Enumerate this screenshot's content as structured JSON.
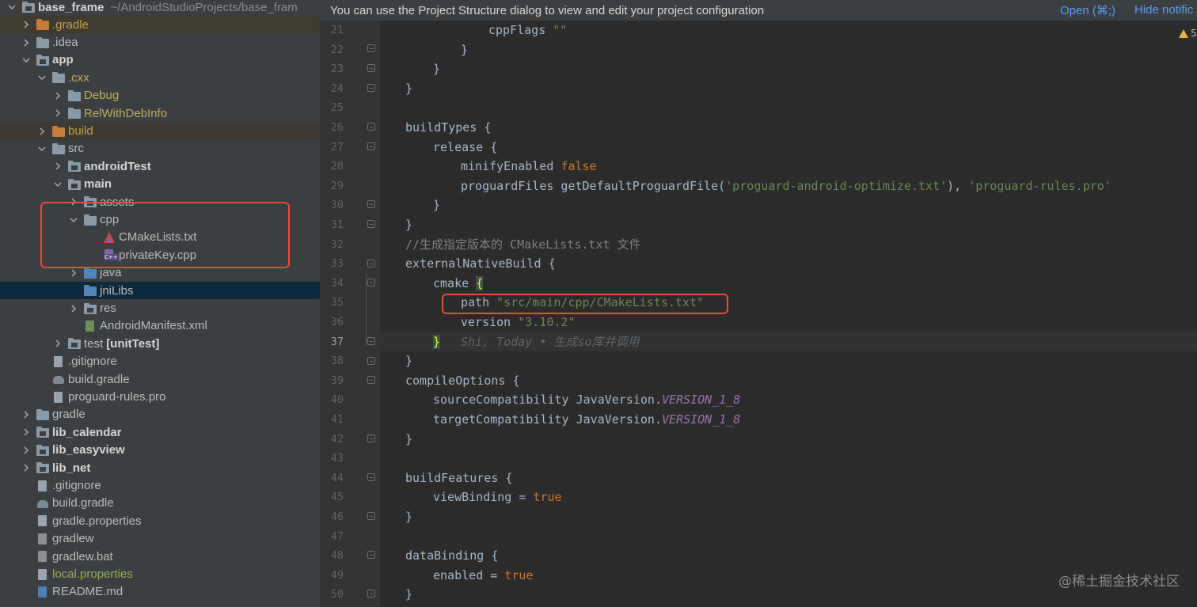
{
  "project_tree": {
    "header": {
      "name": "base_frame",
      "path": "~/AndroidStudioProjects/base_fram"
    },
    "items": [
      {
        "label": ".gradle"
      },
      {
        "label": ".idea"
      },
      {
        "label": "app"
      },
      {
        "label": ".cxx"
      },
      {
        "label": "Debug"
      },
      {
        "label": "RelWithDebInfo"
      },
      {
        "label": "build"
      },
      {
        "label": "src"
      },
      {
        "label": "androidTest"
      },
      {
        "label": "main"
      },
      {
        "label": "assets"
      },
      {
        "label": "cpp"
      },
      {
        "label": "CMakeLists.txt"
      },
      {
        "label": "privateKey.cpp"
      },
      {
        "label": "java"
      },
      {
        "label": "jniLibs"
      },
      {
        "label": "res"
      },
      {
        "label": "AndroidManifest.xml"
      },
      {
        "label": "test",
        "extra": "[unitTest]"
      },
      {
        "label": ".gitignore"
      },
      {
        "label": "build.gradle"
      },
      {
        "label": "proguard-rules.pro"
      },
      {
        "label": "gradle"
      },
      {
        "label": "lib_calendar"
      },
      {
        "label": "lib_easyview"
      },
      {
        "label": "lib_net"
      },
      {
        "label": ".gitignore"
      },
      {
        "label": "build.gradle"
      },
      {
        "label": "gradle.properties"
      },
      {
        "label": "gradlew"
      },
      {
        "label": "gradlew.bat"
      },
      {
        "label": "local.properties"
      },
      {
        "label": "README.md"
      }
    ]
  },
  "notification": {
    "message": "You can use the Project Structure dialog to view and edit your project configuration",
    "open_link": "Open (⌘;)",
    "hide_link": "Hide notific"
  },
  "editor": {
    "warning_count": "5",
    "current_line": 37,
    "lines": [
      {
        "no": "21"
      },
      {
        "no": "22"
      },
      {
        "no": "23"
      },
      {
        "no": "24"
      },
      {
        "no": "25"
      },
      {
        "no": "26"
      },
      {
        "no": "27"
      },
      {
        "no": "28"
      },
      {
        "no": "29"
      },
      {
        "no": "30"
      },
      {
        "no": "31"
      },
      {
        "no": "32"
      },
      {
        "no": "33"
      },
      {
        "no": "34"
      },
      {
        "no": "35"
      },
      {
        "no": "36"
      },
      {
        "no": "37"
      },
      {
        "no": "38"
      },
      {
        "no": "39"
      },
      {
        "no": "40"
      },
      {
        "no": "41"
      },
      {
        "no": "42"
      },
      {
        "no": "43"
      },
      {
        "no": "44"
      },
      {
        "no": "45"
      },
      {
        "no": "46"
      },
      {
        "no": "47"
      },
      {
        "no": "48"
      },
      {
        "no": "49"
      },
      {
        "no": "50"
      }
    ],
    "code": {
      "l21": {
        "t1": "cppFlags ",
        "t2": "\"\""
      },
      "l22": {
        "t1": "}"
      },
      "l23": {
        "t1": "}"
      },
      "l24": {
        "t1": "}"
      },
      "l26": {
        "t1": "buildTypes {"
      },
      "l27": {
        "t1": "release {"
      },
      "l28": {
        "t1": "minifyEnabled ",
        "t2": "false"
      },
      "l29": {
        "t1": "proguardFiles getDefaultProguardFile(",
        "t2": "'proguard-android-optimize.txt'",
        "t3": "), ",
        "t4": "'proguard-rules.pro'"
      },
      "l30": {
        "t1": "}"
      },
      "l31": {
        "t1": "}"
      },
      "l32": {
        "t1": "//生成指定版本的 CMakeLists.txt 文件"
      },
      "l33": {
        "t1": "externalNativeBuild {"
      },
      "l34": {
        "t1": "cmake ",
        "t2": "{"
      },
      "l35": {
        "t1": "path ",
        "t2": "\"src/main/cpp/CMakeLists.txt\""
      },
      "l36": {
        "t1": "version ",
        "t2": "\"3.10.2\""
      },
      "l37": {
        "t1": "}",
        "t2": "Shi, Today • 生成so库并调用"
      },
      "l38": {
        "t1": "}"
      },
      "l39": {
        "t1": "compileOptions {"
      },
      "l40": {
        "t1": "sourceCompatibility JavaVersion.",
        "t2": "VERSION_1_8"
      },
      "l41": {
        "t1": "targetCompatibility JavaVersion.",
        "t2": "VERSION_1_8"
      },
      "l42": {
        "t1": "}"
      },
      "l44": {
        "t1": "buildFeatures {"
      },
      "l45": {
        "t1": "viewBinding = ",
        "t2": "true"
      },
      "l46": {
        "t1": "}"
      },
      "l48": {
        "t1": "dataBinding {"
      },
      "l49": {
        "t1": "enabled = ",
        "t2": "true"
      },
      "l50": {
        "t1": "}"
      }
    }
  },
  "watermark": "@稀土掘金技术社区",
  "colors": {
    "highlight_box": "#e74c3c",
    "keyword": "#cc7832",
    "string": "#6a8759",
    "constant": "#9876aa",
    "link": "#589df6"
  }
}
